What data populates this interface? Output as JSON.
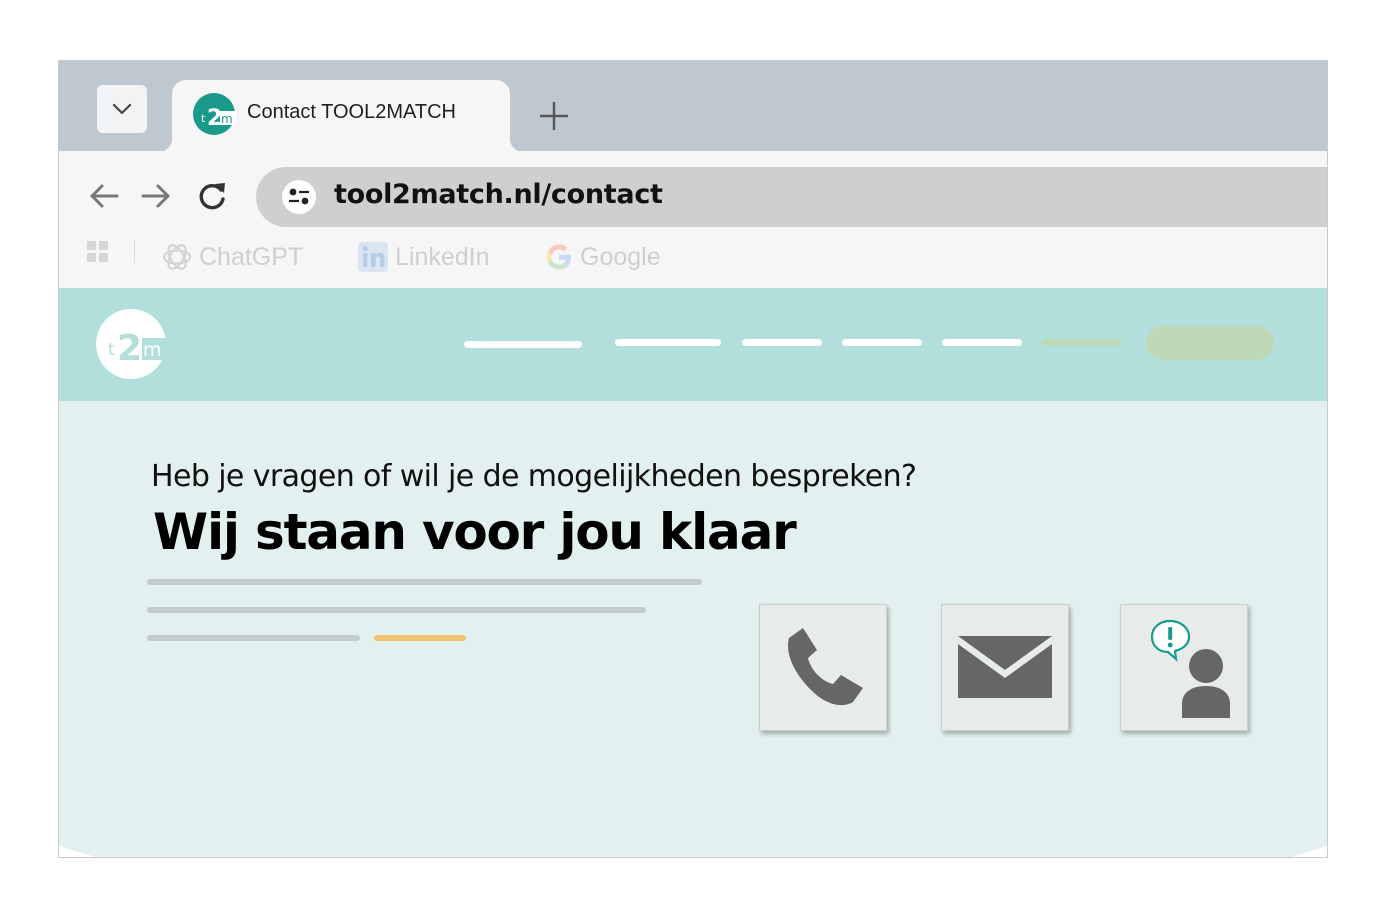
{
  "browser": {
    "tab": {
      "title": "Contact TOOL2MATCH",
      "favicon": "t2m-logo-icon"
    },
    "new_tab_symbol": "+",
    "address_bar": {
      "url": "tool2match.nl/contact"
    },
    "bookmarks": [
      {
        "label": "ChatGPT",
        "icon": "chatgpt-icon"
      },
      {
        "label": "LinkedIn",
        "icon": "linkedin-icon"
      },
      {
        "label": "Google",
        "icon": "google-icon"
      }
    ]
  },
  "site": {
    "logo_text": "t2m",
    "hero": {
      "lead": "Heb je vragen of wil je de mogelijkheden bespreken?",
      "title": "Wij staan voor jou klaar"
    },
    "contact_options": [
      {
        "icon": "phone-icon"
      },
      {
        "icon": "mail-icon"
      },
      {
        "icon": "support-person-icon"
      }
    ]
  },
  "colors": {
    "brand_teal": "#1a9a8a",
    "header_bg": "#b2dfdb",
    "hero_bg": "#e2f1ef",
    "accent_yellow": "#f2c46e",
    "accent_green": "#bdd9b5",
    "icon_gray": "#666666"
  }
}
